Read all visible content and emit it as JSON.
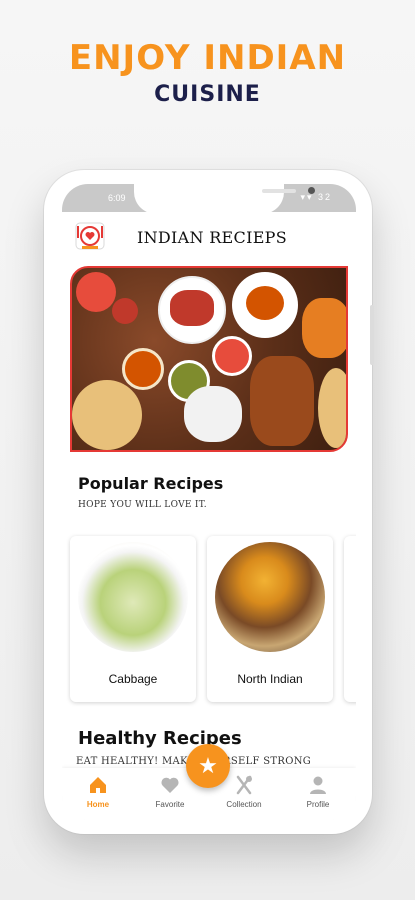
{
  "promo": {
    "headline": "ENJOY INDIAN",
    "subheadline": "CUISINE"
  },
  "status_bar": {
    "time": "6:09",
    "icons": "▾▾ 32"
  },
  "app_bar": {
    "title": "INDIAN RECIEPS"
  },
  "popular": {
    "title": "Popular Recipes",
    "subtitle": "HOPE YOU WILL LOVE IT.",
    "items": [
      {
        "label": "Cabbage"
      },
      {
        "label": "North Indian"
      }
    ]
  },
  "healthy": {
    "title": "Healthy Recipes",
    "subtitle": "EAT HEALTHY! MAKE YOURSELF STRONG"
  },
  "bottom_nav": {
    "fab_icon": "star-icon",
    "items": [
      {
        "label": "Home",
        "icon": "home-icon",
        "active": true
      },
      {
        "label": "Favorite",
        "icon": "heart-icon",
        "active": false
      },
      {
        "label": "Collection",
        "icon": "fork-knife-icon",
        "active": false
      },
      {
        "label": "Profile",
        "icon": "person-icon",
        "active": false
      }
    ]
  },
  "colors": {
    "accent": "#f7931e",
    "headline_dark": "#1c1f4a",
    "banner_border": "#e53935"
  }
}
